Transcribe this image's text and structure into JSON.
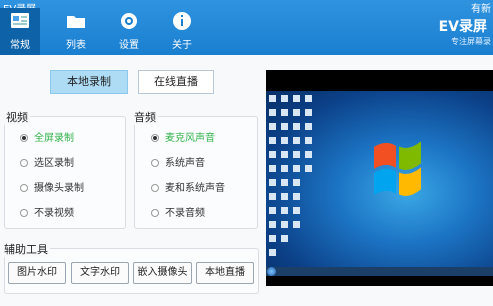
{
  "window": {
    "title": "EV录屏",
    "controls": "有新"
  },
  "nav": {
    "items": [
      {
        "label": "常规"
      },
      {
        "label": "列表"
      },
      {
        "label": "设置"
      },
      {
        "label": "关于"
      }
    ]
  },
  "brand": {
    "name": "EV录屏",
    "tagline": "专注屏幕录"
  },
  "mode_buttons": {
    "local": "本地录制",
    "live": "在线直播"
  },
  "video": {
    "title": "视频",
    "options": [
      "全屏录制",
      "选区录制",
      "摄像头录制",
      "不录视频"
    ],
    "selected": "全屏录制"
  },
  "audio": {
    "title": "音频",
    "options": [
      "麦克风声音",
      "系统声音",
      "麦和系统声音",
      "不录音频"
    ],
    "selected": "麦克风声音"
  },
  "tools": {
    "title": "辅助工具",
    "buttons": [
      "图片水印",
      "文字水印",
      "嵌入摄像头",
      "本地直播"
    ]
  },
  "colors": {
    "header": "#1a7fcf",
    "active_tab": "#0e63a8",
    "selected_option": "#31b24b",
    "active_button": "#aedcf5"
  }
}
